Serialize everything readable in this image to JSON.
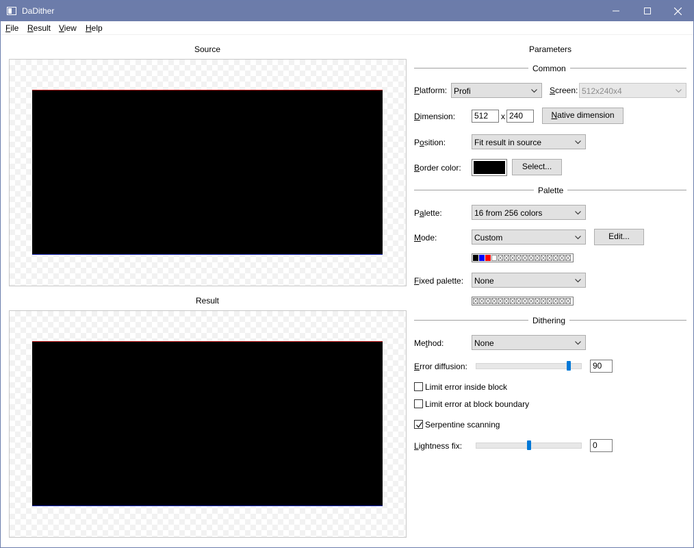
{
  "window": {
    "title": "DaDither"
  },
  "menu": [
    {
      "label_pre": "",
      "label_u": "F",
      "label_post": "ile"
    },
    {
      "label_pre": "",
      "label_u": "R",
      "label_post": "esult"
    },
    {
      "label_pre": "",
      "label_u": "V",
      "label_post": "iew"
    },
    {
      "label_pre": "",
      "label_u": "H",
      "label_post": "elp"
    }
  ],
  "source": {
    "title": "Source"
  },
  "result": {
    "title": "Result"
  },
  "params": {
    "title": "Parameters",
    "common": {
      "title": "Common",
      "platform_label_u": "P",
      "platform_label_rest": "latform:",
      "platform_value": "Profi",
      "screen_label_u": "S",
      "screen_label_rest": "creen:",
      "screen_value": "512x240x4",
      "dimension_label_u": "D",
      "dimension_label_rest": "imension:",
      "dim_width": "512",
      "dim_x": "x",
      "dim_height": "240",
      "native_button_u": "N",
      "native_button_rest": "ative dimension",
      "position_label_pre": "P",
      "position_label_u": "o",
      "position_label_rest": "sition:",
      "position_value": "Fit result in source",
      "border_label_u": "B",
      "border_label_rest": "order color:",
      "border_color": "#000000",
      "select_button": "Select..."
    },
    "palette": {
      "title": "Palette",
      "palette_label_pre": "P",
      "palette_label_u": "a",
      "palette_label_rest": "lette:",
      "palette_value": "16 from 256 colors",
      "mode_label_u": "M",
      "mode_label_rest": "ode:",
      "mode_value": "Custom",
      "edit_button": "Edit...",
      "mode_colors": [
        "#000000",
        "#0000ff",
        "#ff0000",
        "#ffffff"
      ],
      "fixed_label_u": "F",
      "fixed_label_rest": "ixed palette:",
      "fixed_value": "None"
    },
    "dithering": {
      "title": "Dithering",
      "method_label_pre": "Me",
      "method_label_u": "t",
      "method_label_rest": "hod:",
      "method_value": "None",
      "error_label_u": "E",
      "error_label_rest": "rror diffusion:",
      "error_value": "90",
      "error_fraction": 0.9,
      "limit_inside": "Limit error inside block",
      "limit_inside_checked": false,
      "limit_boundary": "Limit error at block boundary",
      "limit_boundary_checked": false,
      "serpentine": "Serpentine scanning",
      "serpentine_checked": true,
      "lightness_label_u": "L",
      "lightness_label_rest": "ightness fix:",
      "lightness_value": "0",
      "lightness_fraction": 0.5
    }
  }
}
